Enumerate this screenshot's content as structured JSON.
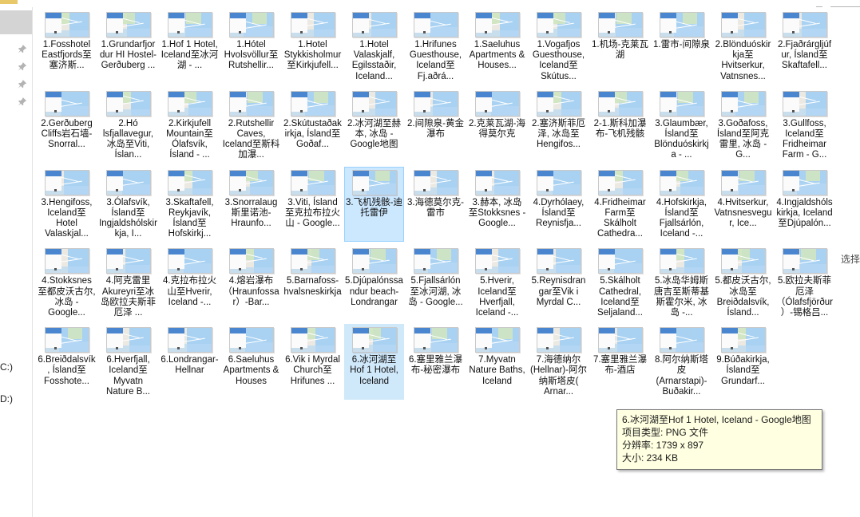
{
  "window": {
    "app": "windows-file-explorer",
    "view_mode": "medium-icons"
  },
  "nav_pane": {
    "pin_icon": "pin-icon",
    "pins": [
      "pin-icon",
      "pin-icon",
      "pin-icon",
      "pin-icon"
    ],
    "drives": [
      "C:)",
      "D:)"
    ]
  },
  "preview_pane": {
    "clipped_text": "选择"
  },
  "tooltip": {
    "name": "6.冰河湖至Hof 1 Hotel, Iceland - Google地图",
    "type": "项目类型: PNG 文件",
    "resolution": "分辨率: 1739 x 897",
    "size": "大小: 234 KB"
  },
  "files": [
    {
      "label": "1.Fosshotel Eastfjords至塞济斯...",
      "state": "normal"
    },
    {
      "label": "1.Grundarfjordur HI Hostel-Gerðuberg ...",
      "state": "normal"
    },
    {
      "label": "1.Hof 1 Hotel, Iceland至冰河湖 - ...",
      "state": "normal"
    },
    {
      "label": "1.Hótel Hvolsvöllur至Rutshellir...",
      "state": "normal"
    },
    {
      "label": "1.Hotel Stykkisholmur至Kirkjufell...",
      "state": "normal"
    },
    {
      "label": "1.Hotel Valaskjalf, Egilsstaðir, Iceland...",
      "state": "normal"
    },
    {
      "label": "1.Hrifunes Guesthouse, Iceland至Fj.aðrá...",
      "state": "normal"
    },
    {
      "label": "1.Saeluhus Apartments & Houses...",
      "state": "normal"
    },
    {
      "label": "1.Vogafjos Guesthouse, Iceland至Skútus...",
      "state": "normal"
    },
    {
      "label": "1.机场-克莱瓦湖",
      "state": "normal"
    },
    {
      "label": "1.雷市-间隙泉",
      "state": "normal"
    },
    {
      "label": "2.Blönduóskirkja至Hvitserkur, Vatnsnes...",
      "state": "normal"
    },
    {
      "label": "2.Fjaðrárgljúfur, Ísland至Skaftafell...",
      "state": "normal"
    },
    {
      "label": "2.Gerðuberg Cliffs岩石墙-Snorral...",
      "state": "normal"
    },
    {
      "label": "2.Hó lsfjallavegur, 冰岛至Viti, Íslan...",
      "state": "normal"
    },
    {
      "label": "2.Kirkjufell Mountain至Ólafsvík, Ísland - ...",
      "state": "normal"
    },
    {
      "label": "2.Rutshellir Caves, Iceland至斯科加瀑...",
      "state": "normal"
    },
    {
      "label": "2.Skútustaðakirkja, Ísland至Goðaf...",
      "state": "normal"
    },
    {
      "label": "2.冰河湖至赫本, 冰岛 - Google地图",
      "state": "normal"
    },
    {
      "label": "2.间隙泉-黄金瀑布",
      "state": "normal"
    },
    {
      "label": "2.克莱瓦湖-海得莫尔克",
      "state": "normal"
    },
    {
      "label": "2.塞济斯菲厄泽, 冰岛至Hengifos...",
      "state": "normal"
    },
    {
      "label": "2-1.斯科加瀑布-飞机残骸",
      "state": "normal"
    },
    {
      "label": "3.Glaumbær, Ísland至Blönduóskirkja - ...",
      "state": "normal"
    },
    {
      "label": "3.Goðafoss, Ísland至阿克雷里, 冰岛 - G...",
      "state": "normal"
    },
    {
      "label": "3.Gullfoss, Iceland至Fridheimar Farm - G...",
      "state": "normal"
    },
    {
      "label": "3.Hengifoss, Iceland至Hotel Valaskjal...",
      "state": "normal"
    },
    {
      "label": "3.Ólafsvík, Ísland至Ingjaldshólskirkja, I...",
      "state": "normal"
    },
    {
      "label": "3.Skaftafell, Reykjavík, Ísland至Hofskirkj...",
      "state": "normal"
    },
    {
      "label": "3.Snorralaug斯里诺池-Hraunfo...",
      "state": "normal"
    },
    {
      "label": "3.Viti, Ísland至克拉布拉火山 - Google...",
      "state": "normal"
    },
    {
      "label": "3.飞机残骸-迪托雷伊",
      "state": "selected"
    },
    {
      "label": "3.海德莫尔克-雷市",
      "state": "normal"
    },
    {
      "label": "3.赫本, 冰岛至Stokksnes - Google...",
      "state": "normal"
    },
    {
      "label": "4.Dyrhólaey, Ísland至Reynisfja...",
      "state": "normal"
    },
    {
      "label": "4.Fridheimar Farm至Skálholt Cathedra...",
      "state": "normal"
    },
    {
      "label": "4.Hofskirkja, Ísland至Fjallsárlón, Iceland -...",
      "state": "normal"
    },
    {
      "label": "4.Hvitserkur, Vatnsnesvegur, Ice...",
      "state": "normal"
    },
    {
      "label": "4.Ingjaldshólskirkja, Iceland至Djúpalón...",
      "state": "normal"
    },
    {
      "label": "4.Stokksnes至都皮沃古尔, 冰岛 - Google...",
      "state": "normal"
    },
    {
      "label": "4.阿克雷里Akureyri至冰岛欧拉夫斯菲厄泽 ...",
      "state": "normal"
    },
    {
      "label": "4.克拉布拉火山至Hverir, Iceland -...",
      "state": "normal"
    },
    {
      "label": "4.熔岩瀑布（Hraunfossar）-Bar...",
      "state": "normal"
    },
    {
      "label": "5.Barnafoss-hvalsneskirkja",
      "state": "normal"
    },
    {
      "label": "5.Djúpalónssandur beach-Londrangar",
      "state": "normal"
    },
    {
      "label": "5.Fjallsárlón至冰河湖, 冰岛 - Google...",
      "state": "normal"
    },
    {
      "label": "5.Hverir, Iceland至Hverfjall, Iceland -...",
      "state": "normal"
    },
    {
      "label": "5.Reynisdrangar至Vik i Myrdal C...",
      "state": "normal"
    },
    {
      "label": "5.Skálholt Cathedral, Iceland至Seljaland...",
      "state": "normal"
    },
    {
      "label": "5.冰岛华姆斯唐吉至斯蒂基斯霍尔米, 冰岛 -...",
      "state": "normal"
    },
    {
      "label": "5.都皮沃古尔, 冰岛至Breiðdalsvík, Ísland...",
      "state": "normal"
    },
    {
      "label": "5.欧拉夫斯菲厄泽（Ólafsfjörður）-锡格吕...",
      "state": "normal"
    },
    {
      "label": "6.Breiðdalsvík, Ísland至Fosshote...",
      "state": "normal"
    },
    {
      "label": "6.Hverfjall, Iceland至Myvatn Nature B...",
      "state": "normal"
    },
    {
      "label": "6.Londrangar-Hellnar",
      "state": "normal"
    },
    {
      "label": "6.Saeluhus Apartments & Houses",
      "state": "normal"
    },
    {
      "label": "6.Vik i Myrdal Church至Hrifunes ...",
      "state": "normal"
    },
    {
      "label": "6.冰河湖至Hof 1 Hotel, Iceland",
      "state": "hover"
    },
    {
      "label": "6.塞里雅兰瀑布-秘密瀑布",
      "state": "normal"
    },
    {
      "label": "7.Myvatn Nature Baths, Iceland",
      "state": "normal"
    },
    {
      "label": "7.海德纳尔(Hellnar)-阿尔纳斯塔皮( Arnar...",
      "state": "normal"
    },
    {
      "label": "7.塞里雅兰瀑布-酒店",
      "state": "normal"
    },
    {
      "label": "8.阿尔纳斯塔皮(Arnarstapi)-Buðakir...",
      "state": "normal"
    },
    {
      "label": "9.Búðakirkja, Ísland至Grundarf...",
      "state": "normal"
    }
  ]
}
